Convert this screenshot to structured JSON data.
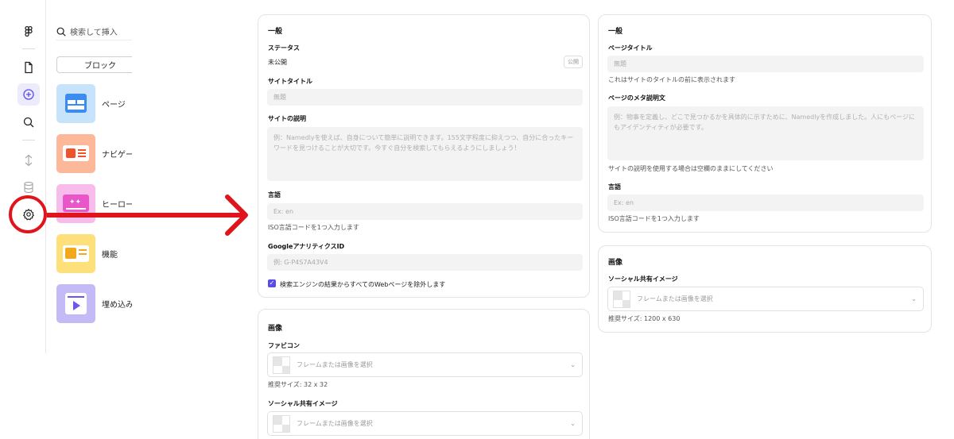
{
  "insert_panel": {
    "search_placeholder": "検索して挿入",
    "block_button": "ブロック",
    "categories": [
      {
        "label": "ページ",
        "color": "#c7e3fb"
      },
      {
        "label": "ナビゲー",
        "color": "#fdb89a"
      },
      {
        "label": "ヒーロー",
        "color": "#f8bcec"
      },
      {
        "label": "機能",
        "color": "#fde07a"
      },
      {
        "label": "埋め込み",
        "color": "#c3baf6"
      }
    ]
  },
  "site_settings": {
    "general": {
      "title": "一般",
      "status_label": "ステータス",
      "status_value": "未公開",
      "status_button": "公開",
      "site_title_label": "サイトタイトル",
      "site_title_placeholder": "無題",
      "description_label": "サイトの説明",
      "description_placeholder": "例：Namedlyを使えば、自身について簡単に説明できます。155文字程度に抑えつつ、自分に合ったキーワードを見つけることが大切です。今すぐ自分を検索してもらえるようにしましょう！",
      "language_label": "言語",
      "language_placeholder": "Ex: en",
      "language_hint": "ISO言語コードを1つ入力します",
      "ga_label": "GoogleアナリティクスID",
      "ga_placeholder": "例: G-P4S7A43V4",
      "exclude_label": "検索エンジンの結果からすべてのWebページを除外します",
      "exclude_checked": true
    },
    "image": {
      "title": "画像",
      "favicon_label": "ファビコン",
      "favicon_placeholder": "フレームまたは画像を選択",
      "favicon_hint": "推奨サイズ: 32 x 32",
      "social_label": "ソーシャル共有イメージ",
      "social_placeholder": "フレームまたは画像を選択"
    }
  },
  "page_settings": {
    "general": {
      "title": "一般",
      "page_title_label": "ページタイトル",
      "page_title_placeholder": "無題",
      "page_title_hint": "これはサイトのタイトルの前に表示されます",
      "meta_label": "ページのメタ説明文",
      "meta_placeholder": "例：物事を定義し、どこで見つかるかを具体的に示すために、Namedlyを作成しました。人にもページにもアイデンティティが必要です。",
      "meta_hint": "サイトの説明を使用する場合は空欄のままにしてください",
      "language_label": "言語",
      "language_placeholder": "Ex: en",
      "language_hint": "ISO言語コードを1つ入力します"
    },
    "image": {
      "title": "画像",
      "social_label": "ソーシャル共有イメージ",
      "social_placeholder": "フレームまたは画像を選択",
      "social_hint": "推奨サイズ: 1200 x 630"
    }
  },
  "colors": {
    "accent": "#5b4ce6",
    "annotation": "#e0141c"
  }
}
